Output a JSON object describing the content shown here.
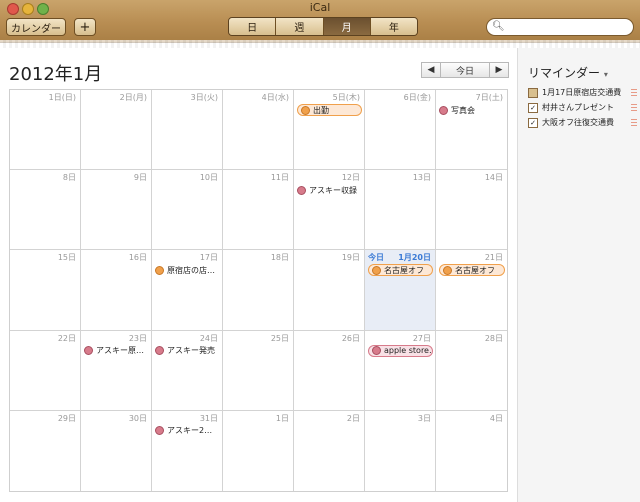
{
  "window": {
    "title": "iCal"
  },
  "toolbar": {
    "calendars_label": "カレンダー",
    "add_label": "+",
    "views": [
      {
        "label": "日",
        "active": false
      },
      {
        "label": "週",
        "active": false
      },
      {
        "label": "月",
        "active": true
      },
      {
        "label": "年",
        "active": false
      }
    ],
    "search": {
      "value": "",
      "placeholder": ""
    }
  },
  "header": {
    "month_title": "2012年1月",
    "prev": "◀",
    "today": "今日",
    "next": "▶"
  },
  "colors": {
    "orange": "#f0a04b",
    "pink": "#d77b8b",
    "today_blue": "#3a7ad5"
  },
  "weeks": [
    [
      {
        "day": "1日(日)",
        "events": []
      },
      {
        "day": "2日(月)",
        "events": []
      },
      {
        "day": "3日(火)",
        "events": []
      },
      {
        "day": "4日(水)",
        "events": []
      },
      {
        "day": "5日(木)",
        "events": [
          {
            "title": "出勤",
            "color": "orange",
            "pill": true
          }
        ]
      },
      {
        "day": "6日(金)",
        "events": []
      },
      {
        "day": "7日(土)",
        "events": [
          {
            "title": "写真会",
            "color": "pink",
            "pill": false
          }
        ]
      }
    ],
    [
      {
        "day": "8日",
        "events": []
      },
      {
        "day": "9日",
        "events": []
      },
      {
        "day": "10日",
        "events": []
      },
      {
        "day": "11日",
        "events": []
      },
      {
        "day": "12日",
        "events": [
          {
            "title": "アスキー収録",
            "color": "pink",
            "pill": false
          }
        ]
      },
      {
        "day": "13日",
        "events": []
      },
      {
        "day": "14日",
        "events": []
      }
    ],
    [
      {
        "day": "15日",
        "events": []
      },
      {
        "day": "16日",
        "events": []
      },
      {
        "day": "17日",
        "events": [
          {
            "title": "原宿店の店…",
            "color": "orange",
            "pill": false
          }
        ]
      },
      {
        "day": "18日",
        "events": []
      },
      {
        "day": "19日",
        "events": []
      },
      {
        "day": "1月20日",
        "today_label": "今日",
        "today": true,
        "events": [
          {
            "title": "名古屋オフ",
            "color": "orange",
            "pill": true
          }
        ]
      },
      {
        "day": "21日",
        "events": [
          {
            "title": "名古屋オフ",
            "color": "orange",
            "pill": true
          }
        ]
      }
    ],
    [
      {
        "day": "22日",
        "events": []
      },
      {
        "day": "23日",
        "events": [
          {
            "title": "アスキー原…",
            "color": "pink",
            "pill": false
          }
        ]
      },
      {
        "day": "24日",
        "events": [
          {
            "title": "アスキー発売",
            "color": "pink",
            "pill": false
          }
        ]
      },
      {
        "day": "25日",
        "events": []
      },
      {
        "day": "26日",
        "events": []
      },
      {
        "day": "27日",
        "events": [
          {
            "title": "apple store…",
            "color": "pink",
            "pill": true
          }
        ]
      },
      {
        "day": "28日",
        "events": []
      }
    ],
    [
      {
        "day": "29日",
        "events": []
      },
      {
        "day": "30日",
        "events": []
      },
      {
        "day": "31日",
        "events": [
          {
            "title": "アスキー2…",
            "color": "pink",
            "pill": false
          }
        ]
      },
      {
        "day": "1日",
        "events": []
      },
      {
        "day": "2日",
        "events": []
      },
      {
        "day": "3日",
        "events": []
      },
      {
        "day": "4日",
        "events": []
      }
    ]
  ],
  "reminders": {
    "title": "リマインダー",
    "chevron": "▾",
    "items": [
      {
        "text": "1月17日原宿店交通費",
        "checked": false
      },
      {
        "text": "村井さんプレゼント",
        "checked": true
      },
      {
        "text": "大阪オフ往復交通費",
        "checked": true
      }
    ]
  }
}
